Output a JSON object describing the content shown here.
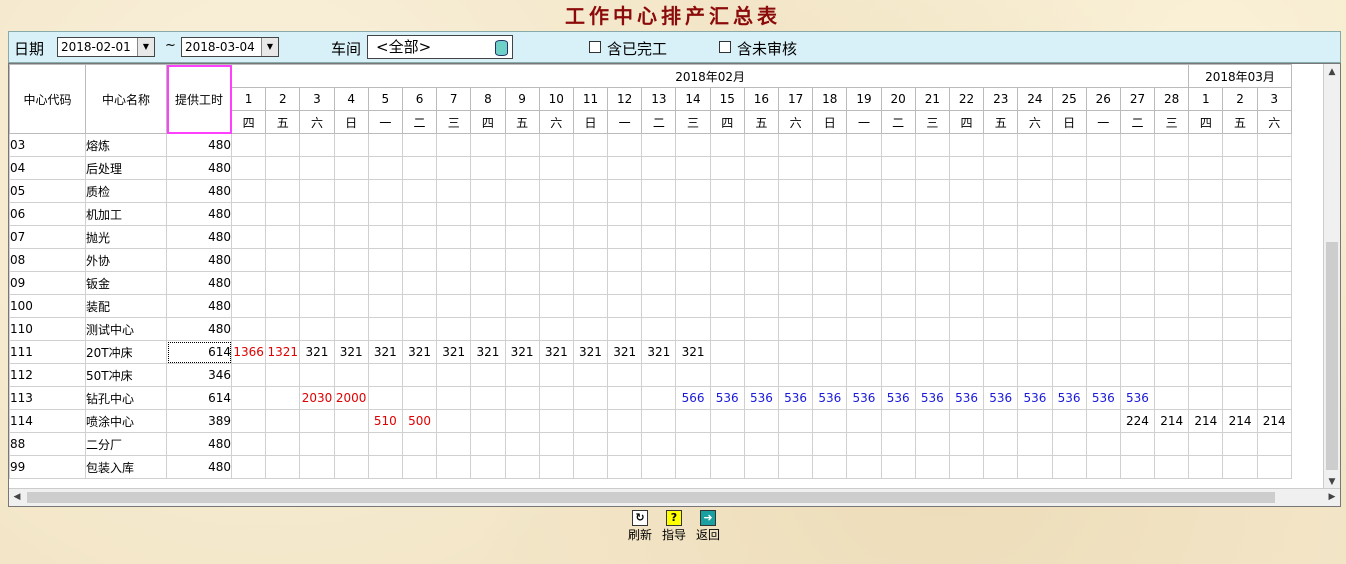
{
  "window": {
    "title": "工作中心排产汇总表"
  },
  "filter": {
    "date_label": "日期",
    "date_from": "2018-02-01",
    "tilde": "~",
    "date_to": "2018-03-04",
    "workshop_label": "车间",
    "workshop_value": "<全部>",
    "include_completed_label": "含已完工",
    "include_completed": false,
    "include_unreviewed_label": "含未审核",
    "include_unreviewed": false
  },
  "table": {
    "headers": {
      "code": "中心代码",
      "name": "中心名称",
      "hours": "提供工时"
    },
    "months": [
      {
        "label": "2018年02月",
        "span": 28
      },
      {
        "label": "2018年03月",
        "span": 3
      }
    ],
    "days": [
      "1",
      "2",
      "3",
      "4",
      "5",
      "6",
      "7",
      "8",
      "9",
      "10",
      "11",
      "12",
      "13",
      "14",
      "15",
      "16",
      "17",
      "18",
      "19",
      "20",
      "21",
      "22",
      "23",
      "24",
      "25",
      "26",
      "27",
      "28",
      "1",
      "2",
      "3"
    ],
    "weekdays": [
      "四",
      "五",
      "六",
      "日",
      "一",
      "二",
      "三",
      "四",
      "五",
      "六",
      "日",
      "一",
      "二",
      "三",
      "四",
      "五",
      "六",
      "日",
      "一",
      "二",
      "三",
      "四",
      "五",
      "六",
      "日",
      "一",
      "二",
      "三",
      "四",
      "五",
      "六"
    ],
    "rows": [
      {
        "code": "03",
        "name": "熔炼",
        "hours": "480",
        "cells": {}
      },
      {
        "code": "04",
        "name": "后处理",
        "hours": "480",
        "cells": {}
      },
      {
        "code": "05",
        "name": "质检",
        "hours": "480",
        "cells": {}
      },
      {
        "code": "06",
        "name": "机加工",
        "hours": "480",
        "cells": {}
      },
      {
        "code": "07",
        "name": "抛光",
        "hours": "480",
        "cells": {}
      },
      {
        "code": "08",
        "name": "外协",
        "hours": "480",
        "cells": {}
      },
      {
        "code": "09",
        "name": "钣金",
        "hours": "480",
        "cells": {}
      },
      {
        "code": "100",
        "name": "装配",
        "hours": "480",
        "cells": {}
      },
      {
        "code": "110",
        "name": "测试中心",
        "hours": "480",
        "cells": {}
      },
      {
        "code": "111",
        "name": "20T冲床",
        "hours": "614",
        "focused": true,
        "cells": {
          "0": [
            "1366",
            "red"
          ],
          "1": [
            "1321",
            "red"
          ],
          "2": [
            "321",
            ""
          ],
          "3": [
            "321",
            ""
          ],
          "4": [
            "321",
            ""
          ],
          "5": [
            "321",
            ""
          ],
          "6": [
            "321",
            ""
          ],
          "7": [
            "321",
            ""
          ],
          "8": [
            "321",
            ""
          ],
          "9": [
            "321",
            ""
          ],
          "10": [
            "321",
            ""
          ],
          "11": [
            "321",
            ""
          ],
          "12": [
            "321",
            ""
          ],
          "13": [
            "321",
            ""
          ]
        }
      },
      {
        "code": "112",
        "name": "50T冲床",
        "hours": "346",
        "cells": {}
      },
      {
        "code": "113",
        "name": "钻孔中心",
        "hours": "614",
        "cells": {
          "2": [
            "2030",
            "red"
          ],
          "3": [
            "2000",
            "red"
          ],
          "13": [
            "566",
            "blue"
          ],
          "14": [
            "536",
            "blue"
          ],
          "15": [
            "536",
            "blue"
          ],
          "16": [
            "536",
            "blue"
          ],
          "17": [
            "536",
            "blue"
          ],
          "18": [
            "536",
            "blue"
          ],
          "19": [
            "536",
            "blue"
          ],
          "20": [
            "536",
            "blue"
          ],
          "21": [
            "536",
            "blue"
          ],
          "22": [
            "536",
            "blue"
          ],
          "23": [
            "536",
            "blue"
          ],
          "24": [
            "536",
            "blue"
          ],
          "25": [
            "536",
            "blue"
          ],
          "26": [
            "536",
            "blue"
          ]
        }
      },
      {
        "code": "114",
        "name": "喷涂中心",
        "hours": "389",
        "cells": {
          "4": [
            "510",
            "red"
          ],
          "5": [
            "500",
            "red"
          ],
          "26": [
            "224",
            ""
          ],
          "27": [
            "214",
            ""
          ],
          "28": [
            "214",
            ""
          ],
          "29": [
            "214",
            ""
          ],
          "30": [
            "214",
            ""
          ]
        }
      },
      {
        "code": "88",
        "name": "二分厂",
        "hours": "480",
        "cells": {}
      },
      {
        "code": "99",
        "name": "包装入库",
        "hours": "480",
        "cells": {}
      }
    ]
  },
  "toolbar": {
    "refresh_label": "刷新",
    "guide_label": "指导",
    "back_label": "返回"
  },
  "colors": {
    "over_capacity": "#e00000",
    "under_capacity": "#1a1adc",
    "title": "#8b0a0a",
    "filter_bg": "#d8f0f8"
  }
}
